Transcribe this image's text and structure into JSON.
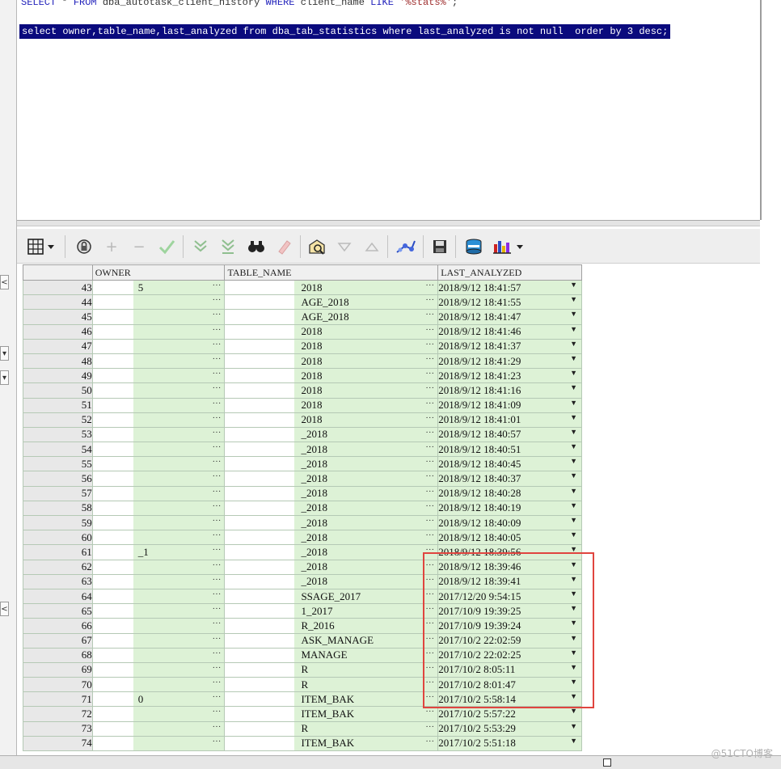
{
  "editor": {
    "line1": {
      "kw1": "SELECT",
      "mid1": " * ",
      "kw2": "FROM",
      "mid2": " dba_autotask_client_history ",
      "kw3": "WHERE",
      "mid3": " client_name ",
      "kw4": "LIKE",
      "mid4": " ",
      "str": "'%stats%'",
      "end": ";"
    },
    "line2": "select owner,table_name,last_analyzed from dba_tab_statistics where last_analyzed is not null  order by 3 desc;"
  },
  "toolbar": {
    "icons": [
      "grid-view-icon",
      "lock-icon",
      "add-record-icon",
      "delete-record-icon",
      "post-edit-icon",
      "fetch-next-icon",
      "fetch-last-icon",
      "find-icon",
      "clear-icon",
      "query-by-example-icon",
      "sort-down-icon",
      "sort-up-icon",
      "explain-plan-icon",
      "save-icon",
      "export-icon",
      "chart-icon"
    ]
  },
  "grid": {
    "columns": [
      "OWNER",
      "TABLE_NAME",
      "LAST_ANALYZED"
    ],
    "rows": [
      {
        "num": "43",
        "owner": "5",
        "table": "2018",
        "date": "2018/9/12 18:41:57"
      },
      {
        "num": "44",
        "owner": "",
        "table": "AGE_2018",
        "date": "2018/9/12 18:41:55"
      },
      {
        "num": "45",
        "owner": "",
        "table": "AGE_2018",
        "date": "2018/9/12 18:41:47"
      },
      {
        "num": "46",
        "owner": "",
        "table": "2018",
        "date": "2018/9/12 18:41:46"
      },
      {
        "num": "47",
        "owner": "",
        "table": "2018",
        "date": "2018/9/12 18:41:37"
      },
      {
        "num": "48",
        "owner": "",
        "table": "2018",
        "date": "2018/9/12 18:41:29"
      },
      {
        "num": "49",
        "owner": "",
        "table": "2018",
        "date": "2018/9/12 18:41:23"
      },
      {
        "num": "50",
        "owner": "",
        "table": "2018",
        "date": "2018/9/12 18:41:16"
      },
      {
        "num": "51",
        "owner": "",
        "table": "2018",
        "date": "2018/9/12 18:41:09"
      },
      {
        "num": "52",
        "owner": "",
        "table": "2018",
        "date": "2018/9/12 18:41:01"
      },
      {
        "num": "53",
        "owner": "",
        "table": "_2018",
        "date": "2018/9/12 18:40:57"
      },
      {
        "num": "54",
        "owner": "",
        "table": "_2018",
        "date": "2018/9/12 18:40:51"
      },
      {
        "num": "55",
        "owner": "",
        "table": "_2018",
        "date": "2018/9/12 18:40:45"
      },
      {
        "num": "56",
        "owner": "",
        "table": "_2018",
        "date": "2018/9/12 18:40:37"
      },
      {
        "num": "57",
        "owner": "",
        "table": "_2018",
        "date": "2018/9/12 18:40:28"
      },
      {
        "num": "58",
        "owner": "",
        "table": "_2018",
        "date": "2018/9/12 18:40:19"
      },
      {
        "num": "59",
        "owner": "",
        "table": "_2018",
        "date": "2018/9/12 18:40:09"
      },
      {
        "num": "60",
        "owner": "",
        "table": "_2018",
        "date": "2018/9/12 18:40:05"
      },
      {
        "num": "61",
        "owner": "_1",
        "table": "_2018",
        "date": "2018/9/12 18:39:56"
      },
      {
        "num": "62",
        "owner": "",
        "table": "_2018",
        "date": "2018/9/12 18:39:46"
      },
      {
        "num": "63",
        "owner": "",
        "table": "_2018",
        "date": "2018/9/12 18:39:41"
      },
      {
        "num": "64",
        "owner": "",
        "table": "SSAGE_2017",
        "date": "2017/12/20 9:54:15"
      },
      {
        "num": "65",
        "owner": "",
        "table": "1_2017",
        "date": "2017/10/9 19:39:25"
      },
      {
        "num": "66",
        "owner": "",
        "table": "R_2016",
        "date": "2017/10/9 19:39:24"
      },
      {
        "num": "67",
        "owner": "",
        "table": "ASK_MANAGE",
        "date": "2017/10/2 22:02:59"
      },
      {
        "num": "68",
        "owner": "",
        "table": "MANAGE",
        "date": "2017/10/2 22:02:25"
      },
      {
        "num": "69",
        "owner": "",
        "table": "R",
        "date": "2017/10/2 8:05:11"
      },
      {
        "num": "70",
        "owner": "",
        "table": "R",
        "date": "2017/10/2 8:01:47"
      },
      {
        "num": "71",
        "owner": "0",
        "table": "ITEM_BAK",
        "date": "2017/10/2 5:58:14"
      },
      {
        "num": "72",
        "owner": "",
        "table": "ITEM_BAK",
        "date": "2017/10/2 5:57:22"
      },
      {
        "num": "73",
        "owner": "",
        "table": "R",
        "date": "2017/10/2 5:53:29"
      },
      {
        "num": "74",
        "owner": "",
        "table": "ITEM_BAK",
        "date": "2017/10/2 5:51:18"
      }
    ]
  },
  "watermark": "@51CTO博客",
  "colors": {
    "selection": "#0a0a7d",
    "cell_bg": "#ddf2d6",
    "highlight": "#e0453f"
  }
}
